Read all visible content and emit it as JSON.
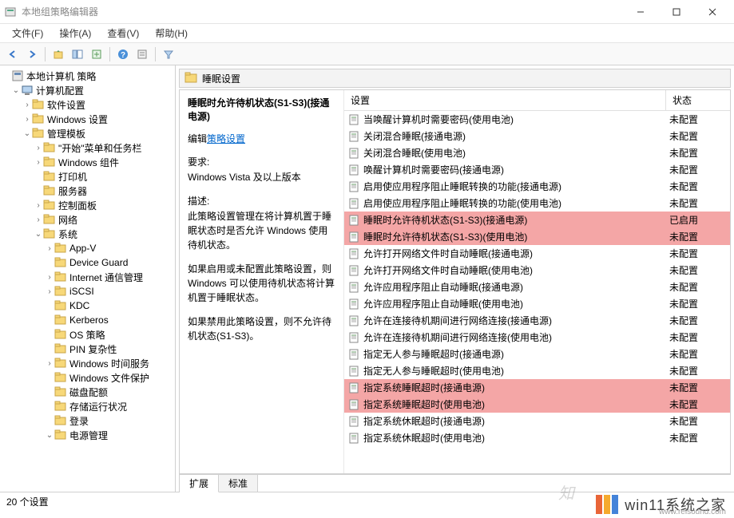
{
  "window": {
    "title": "本地组策略编辑器"
  },
  "menubar": {
    "file": "文件(F)",
    "action": "操作(A)",
    "view": "查看(V)",
    "help": "帮助(H)"
  },
  "tree": [
    {
      "label": "本地计算机 策略",
      "indent": 0,
      "icon": "root",
      "expander": ""
    },
    {
      "label": "计算机配置",
      "indent": 1,
      "icon": "comp",
      "expander": "v"
    },
    {
      "label": "软件设置",
      "indent": 2,
      "icon": "folder",
      "expander": ">"
    },
    {
      "label": "Windows 设置",
      "indent": 2,
      "icon": "folder",
      "expander": ">"
    },
    {
      "label": "管理模板",
      "indent": 2,
      "icon": "folder",
      "expander": "v"
    },
    {
      "label": "\"开始\"菜单和任务栏",
      "indent": 3,
      "icon": "folder",
      "expander": ">"
    },
    {
      "label": "Windows 组件",
      "indent": 3,
      "icon": "folder",
      "expander": ">"
    },
    {
      "label": "打印机",
      "indent": 3,
      "icon": "folder",
      "expander": ""
    },
    {
      "label": "服务器",
      "indent": 3,
      "icon": "folder",
      "expander": ""
    },
    {
      "label": "控制面板",
      "indent": 3,
      "icon": "folder",
      "expander": ">"
    },
    {
      "label": "网络",
      "indent": 3,
      "icon": "folder",
      "expander": ">"
    },
    {
      "label": "系统",
      "indent": 3,
      "icon": "folder",
      "expander": "v"
    },
    {
      "label": "App-V",
      "indent": 4,
      "icon": "folder",
      "expander": ">"
    },
    {
      "label": "Device Guard",
      "indent": 4,
      "icon": "folder",
      "expander": ""
    },
    {
      "label": "Internet 通信管理",
      "indent": 4,
      "icon": "folder",
      "expander": ">"
    },
    {
      "label": "iSCSI",
      "indent": 4,
      "icon": "folder",
      "expander": ">"
    },
    {
      "label": "KDC",
      "indent": 4,
      "icon": "folder",
      "expander": ""
    },
    {
      "label": "Kerberos",
      "indent": 4,
      "icon": "folder",
      "expander": ""
    },
    {
      "label": "OS 策略",
      "indent": 4,
      "icon": "folder",
      "expander": ""
    },
    {
      "label": "PIN 复杂性",
      "indent": 4,
      "icon": "folder",
      "expander": ""
    },
    {
      "label": "Windows 时间服务",
      "indent": 4,
      "icon": "folder",
      "expander": ">"
    },
    {
      "label": "Windows 文件保护",
      "indent": 4,
      "icon": "folder",
      "expander": ""
    },
    {
      "label": "磁盘配额",
      "indent": 4,
      "icon": "folder",
      "expander": ""
    },
    {
      "label": "存储运行状况",
      "indent": 4,
      "icon": "folder",
      "expander": ""
    },
    {
      "label": "登录",
      "indent": 4,
      "icon": "folder",
      "expander": ""
    },
    {
      "label": "电源管理",
      "indent": 4,
      "icon": "folder",
      "expander": "v"
    }
  ],
  "location": "睡眠设置",
  "desc": {
    "title": "睡眠时允许待机状态(S1-S3)(接通电源)",
    "edit_prefix": "编辑",
    "edit_link": "策略设置",
    "req_label": "要求:",
    "req_text": "Windows Vista 及以上版本",
    "desc_label": "描述:",
    "desc_text1": "此策略设置管理在将计算机置于睡眠状态时是否允许 Windows 使用待机状态。",
    "desc_text2": "如果启用或未配置此策略设置，则 Windows 可以使用待机状态将计算机置于睡眠状态。",
    "desc_text3": "如果禁用此策略设置，则不允许待机状态(S1-S3)。"
  },
  "list_header": {
    "setting": "设置",
    "state": "状态"
  },
  "settings": [
    {
      "name": "当唤醒计算机时需要密码(使用电池)",
      "state": "未配置",
      "hl": false
    },
    {
      "name": "关闭混合睡眠(接通电源)",
      "state": "未配置",
      "hl": false
    },
    {
      "name": "关闭混合睡眠(使用电池)",
      "state": "未配置",
      "hl": false
    },
    {
      "name": "唤醒计算机时需要密码(接通电源)",
      "state": "未配置",
      "hl": false
    },
    {
      "name": "启用使应用程序阻止睡眠转换的功能(接通电源)",
      "state": "未配置",
      "hl": false
    },
    {
      "name": "启用使应用程序阻止睡眠转换的功能(使用电池)",
      "state": "未配置",
      "hl": false
    },
    {
      "name": "睡眠时允许待机状态(S1-S3)(接通电源)",
      "state": "已启用",
      "hl": true
    },
    {
      "name": "睡眠时允许待机状态(S1-S3)(使用电池)",
      "state": "未配置",
      "hl": true
    },
    {
      "name": "允许打开网络文件时自动睡眠(接通电源)",
      "state": "未配置",
      "hl": false
    },
    {
      "name": "允许打开网络文件时自动睡眠(使用电池)",
      "state": "未配置",
      "hl": false
    },
    {
      "name": "允许应用程序阻止自动睡眠(接通电源)",
      "state": "未配置",
      "hl": false
    },
    {
      "name": "允许应用程序阻止自动睡眠(使用电池)",
      "state": "未配置",
      "hl": false
    },
    {
      "name": "允许在连接待机期间进行网络连接(接通电源)",
      "state": "未配置",
      "hl": false
    },
    {
      "name": "允许在连接待机期间进行网络连接(使用电池)",
      "state": "未配置",
      "hl": false
    },
    {
      "name": "指定无人参与睡眠超时(接通电源)",
      "state": "未配置",
      "hl": false
    },
    {
      "name": "指定无人参与睡眠超时(使用电池)",
      "state": "未配置",
      "hl": false
    },
    {
      "name": "指定系统睡眠超时(接通电源)",
      "state": "未配置",
      "hl": true
    },
    {
      "name": "指定系统睡眠超时(使用电池)",
      "state": "未配置",
      "hl": true
    },
    {
      "name": "指定系统休眠超时(接通电源)",
      "state": "未配置",
      "hl": false
    },
    {
      "name": "指定系统休眠超时(使用电池)",
      "state": "未配置",
      "hl": false
    }
  ],
  "tabs": {
    "extended": "扩展",
    "standard": "标准"
  },
  "statusbar": "20 个设置",
  "watermark": {
    "brand": "win11系统之家",
    "site": "www.relsound.com"
  }
}
